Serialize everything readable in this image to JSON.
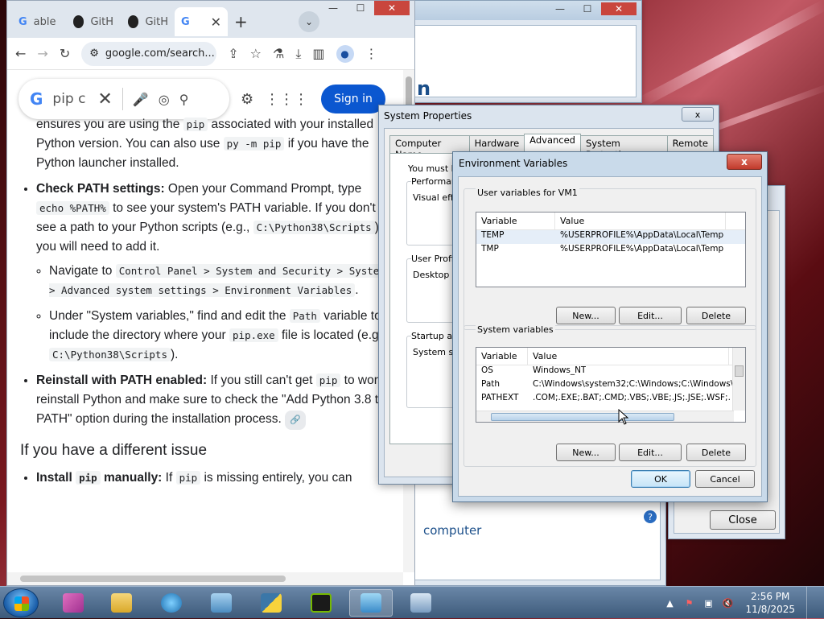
{
  "chrome": {
    "tabs": [
      {
        "icon": "G",
        "label": "able"
      },
      {
        "icon": "github",
        "label": "GitH"
      },
      {
        "icon": "github",
        "label": "GitH"
      },
      {
        "icon": "G",
        "label": ""
      }
    ],
    "address": "google.com/search...",
    "search_query": "pip c",
    "sign_in": "Sign in"
  },
  "article": {
    "intro": [
      "ensures you are using the ",
      "pip",
      " associated with your installed Python version. You can also use ",
      "py -m pip",
      " if you have the Python launcher installed."
    ],
    "b1_title": "Check PATH settings:",
    "b1_text": [
      " Open your Command Prompt, type ",
      "echo %PATH%",
      " to see your system's PATH variable. If you don't see a path to your Python scripts (e.g., ",
      "C:\\Python38\\Scripts",
      "), you will need to add it."
    ],
    "s1": [
      "Navigate to ",
      "Control Panel > System and Security > System > Advanced system settings > Environment Variables",
      "."
    ],
    "s2": [
      "Under \"System variables,\" find and edit the ",
      "Path",
      " variable to include the directory where your ",
      "pip.exe",
      " file is located (e.g., ",
      "C:\\Python38\\Scripts",
      ")."
    ],
    "b2_title": "Reinstall with PATH enabled:",
    "b2_text": [
      " If you still can't get ",
      "pip",
      " to work, reinstall Python and make sure to check the \"Add Python 3.8 to PATH\" option during the installation process."
    ],
    "heading": "If you have a different issue",
    "b3_title": "Install ",
    "b3_code": "pip",
    "b3_title2": " manually:",
    "b3_text": [
      " If ",
      "pip",
      " is missing entirely, you can"
    ]
  },
  "bg_window": {
    "link": "computer",
    "close": "Close"
  },
  "system_properties": {
    "title": "System Properties",
    "close": "x",
    "tabs": [
      "Computer Name",
      "Hardware",
      "Advanced",
      "System Protection",
      "Remote"
    ],
    "selected_tab": "Advanced",
    "text_must": "You must be",
    "grp1": "Performanc",
    "grp1_text": "Visual effec",
    "grp2": "User Profile",
    "grp2_text": "Desktop se",
    "grp3": "Startup and",
    "grp3_text": "System start"
  },
  "env": {
    "title": "Environment Variables",
    "close": "x",
    "user_label": "User variables for VM1",
    "col_variable": "Variable",
    "col_value": "Value",
    "user_vars": [
      {
        "name": "TEMP",
        "value": "%USERPROFILE%\\AppData\\Local\\Temp"
      },
      {
        "name": "TMP",
        "value": "%USERPROFILE%\\AppData\\Local\\Temp"
      }
    ],
    "system_label": "System variables",
    "system_vars": [
      {
        "name": "OS",
        "value": "Windows_NT"
      },
      {
        "name": "Path",
        "value": "C:\\Windows\\system32;C:\\Windows;C:\\Windows\\Sy"
      },
      {
        "name": "PATHEXT",
        "value": ".COM;.EXE;.BAT;.CMD;.VBS;.VBE;.JS;.JSE;.WSF;."
      }
    ],
    "new": "New...",
    "edit": "Edit...",
    "delete": "Delete",
    "ok": "OK",
    "cancel": "Cancel"
  },
  "taskbar": {
    "time": "2:56 PM",
    "date": "11/8/2025"
  },
  "colors": {
    "google_blue": "#0b57d0",
    "taskbar": "#4d6a8c",
    "close_red": "#c0392b"
  }
}
